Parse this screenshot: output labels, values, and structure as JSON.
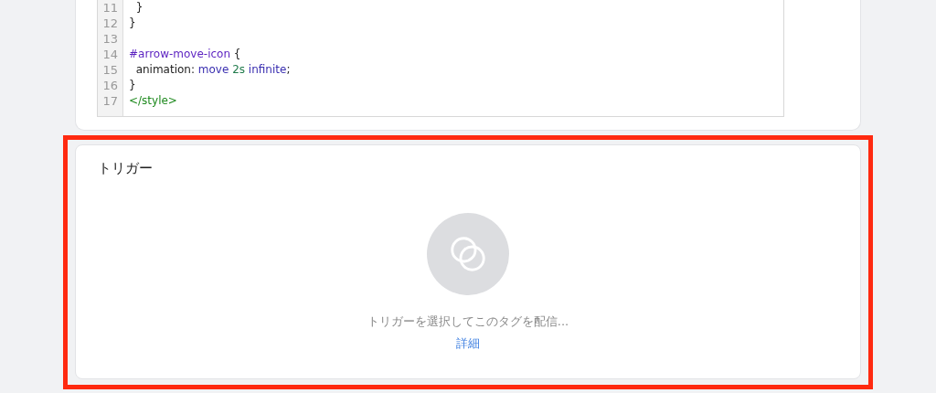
{
  "code_editor": {
    "lines": [
      {
        "number": "11",
        "tokens": [
          {
            "text": "  }",
            "kind": "plain"
          }
        ]
      },
      {
        "number": "12",
        "tokens": [
          {
            "text": "}",
            "kind": "plain"
          }
        ]
      },
      {
        "number": "13"
      },
      {
        "number": "14",
        "tokens": [
          {
            "text": "#arrow-move-icon",
            "kind": "selector"
          },
          {
            "text": " {",
            "kind": "plain"
          }
        ]
      },
      {
        "number": "15",
        "tokens": [
          {
            "text": "  animation: ",
            "kind": "plain"
          },
          {
            "text": "move ",
            "kind": "keyword"
          },
          {
            "text": "2s ",
            "kind": "number"
          },
          {
            "text": "infinite",
            "kind": "keyword"
          },
          {
            "text": ";",
            "kind": "plain"
          }
        ]
      },
      {
        "number": "16",
        "tokens": [
          {
            "text": "}",
            "kind": "plain"
          }
        ]
      },
      {
        "number": "17",
        "tokens": [
          {
            "text": "</style>",
            "kind": "tag"
          }
        ]
      }
    ]
  },
  "trigger_card": {
    "title": "トリガー",
    "highlighted": true,
    "message": "トリガーを選択してこのタグを配信...",
    "link": "詳細"
  }
}
